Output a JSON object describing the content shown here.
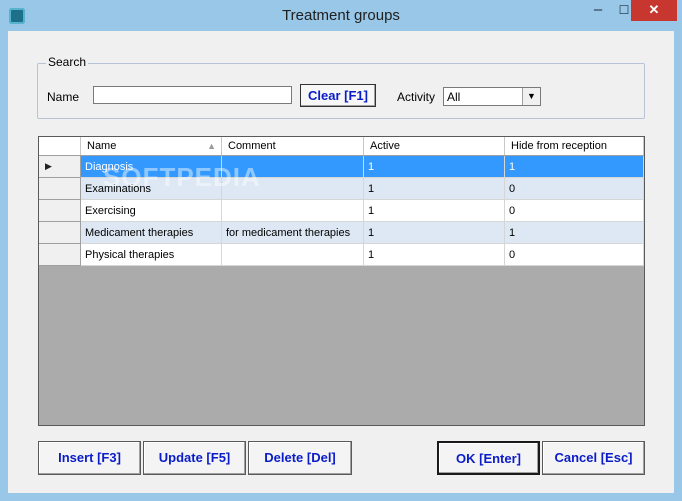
{
  "window": {
    "title": "Treatment groups",
    "min_glyph": "–",
    "max_glyph": "☐",
    "close_glyph": "✕"
  },
  "search": {
    "legend": "Search",
    "name_label": "Name",
    "name_value": "",
    "clear_label": "Clear [F1]",
    "activity_label": "Activity",
    "activity_value": "All"
  },
  "grid": {
    "columns": [
      "Name",
      "Comment",
      "Active",
      "Hide from reception"
    ],
    "rows": [
      {
        "name": "Diagnosis",
        "comment": "",
        "active": "1",
        "hide": "1",
        "selected": true
      },
      {
        "name": "Examinations",
        "comment": "",
        "active": "1",
        "hide": "0"
      },
      {
        "name": "Exercising",
        "comment": "",
        "active": "1",
        "hide": "0"
      },
      {
        "name": "Medicament therapies",
        "comment": "for medicament therapies",
        "active": "1",
        "hide": "1"
      },
      {
        "name": "Physical therapies",
        "comment": "",
        "active": "1",
        "hide": "0"
      }
    ],
    "watermark": "SOFTPEDIA"
  },
  "buttons": {
    "insert": "Insert [F3]",
    "update": "Update [F5]",
    "delete": "Delete [Del]",
    "ok": "OK [Enter]",
    "cancel": "Cancel [Esc]"
  },
  "colors": {
    "selection": "#3399ff",
    "alt_row": "#dde8f4",
    "button_text": "#0a1cc8"
  }
}
